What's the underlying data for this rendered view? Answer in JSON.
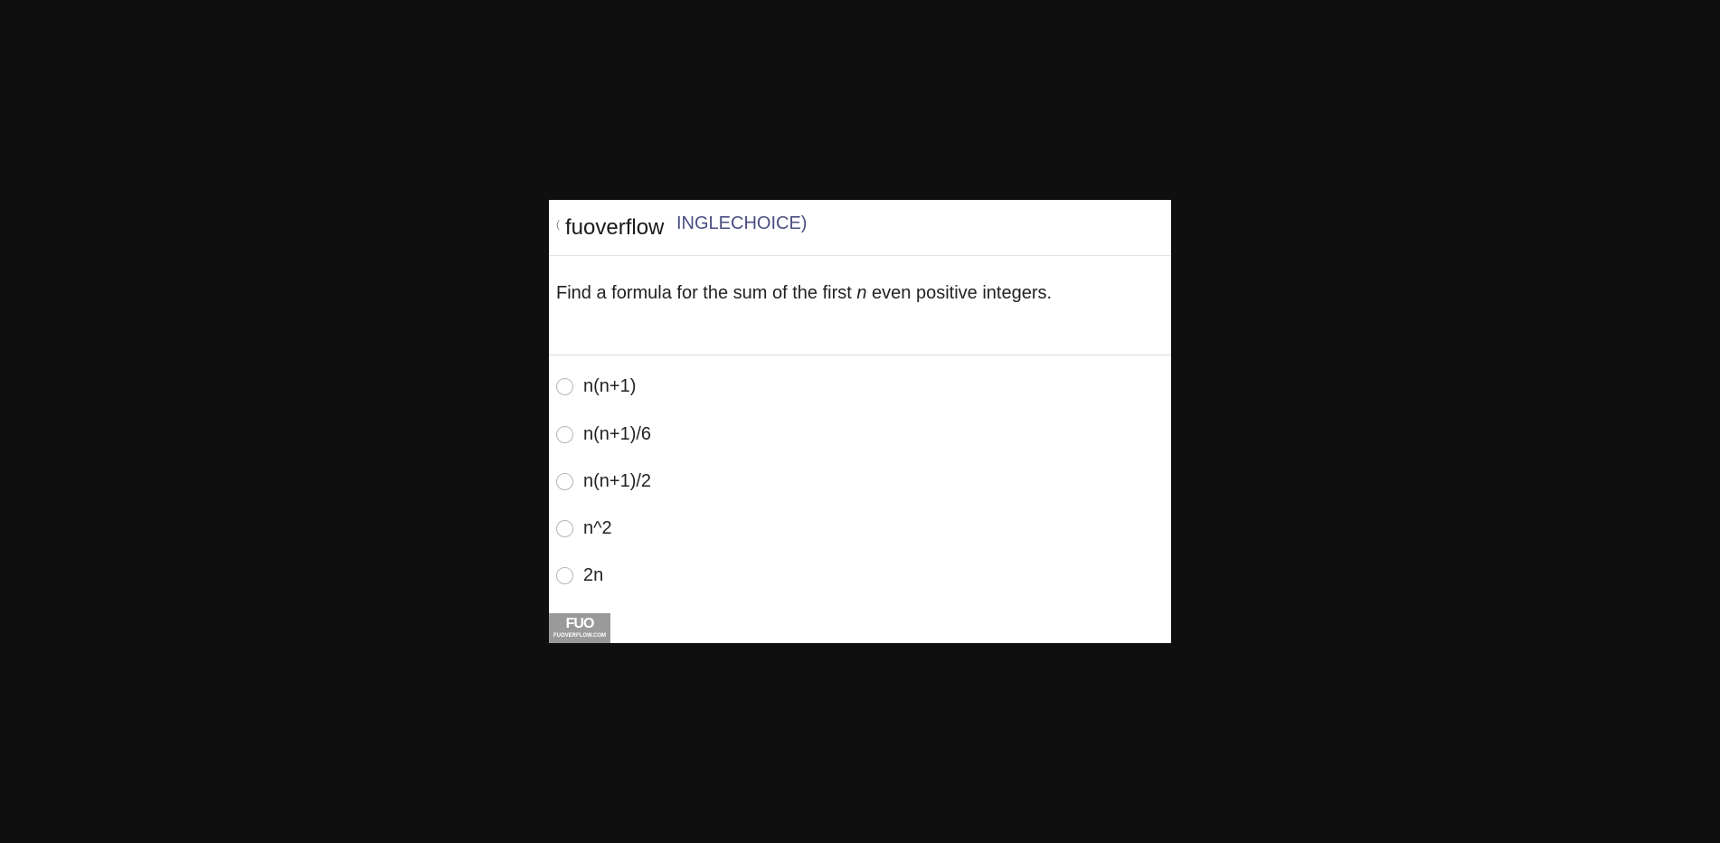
{
  "header": {
    "mark": "(",
    "brand": "fuoverflow",
    "question_type": "INGLECHOICE)"
  },
  "question": {
    "text_before": "Find a formula for the sum of the first ",
    "variable": "n",
    "text_after": " even positive integers."
  },
  "options": [
    {
      "label": "n(n+1)",
      "selected": false
    },
    {
      "label": "n(n+1)/6",
      "selected": false
    },
    {
      "label": "n(n+1)/2",
      "selected": false
    },
    {
      "label": "n^2",
      "selected": false
    },
    {
      "label": "2n",
      "selected": false
    }
  ],
  "logo": {
    "mark": "FUO",
    "sub": "FUOVERFLOW.COM"
  },
  "colors": {
    "background": "#0f0f0f",
    "card": "#ffffff",
    "question_type": "#4a4e80",
    "radio_border": "#b5b5b5",
    "logo_bg": "#9a9a9a"
  }
}
